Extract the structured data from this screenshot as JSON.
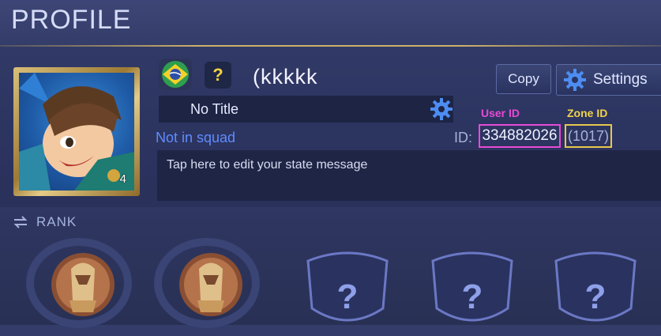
{
  "header": {
    "title": "PROFILE"
  },
  "profile": {
    "avatar_level": "4",
    "country_flag": "brazil-flag-icon",
    "title_badge": "?",
    "player_name": "(kkkkk",
    "title": "No Title",
    "squad_status": "Not in squad",
    "user_id_label": "User ID",
    "zone_id_label": "Zone ID",
    "id_prefix": "ID:",
    "user_id": "334882026",
    "zone_id": "(1017)",
    "state_message": "Tap here to edit your state message"
  },
  "actions": {
    "copy_label": "Copy",
    "settings_label": "Settings"
  },
  "rank": {
    "label": "RANK",
    "slots": [
      {
        "type": "medal",
        "icon": "rank-medal-icon"
      },
      {
        "type": "medal",
        "icon": "rank-medal-icon"
      },
      {
        "type": "unknown",
        "symbol": "?"
      },
      {
        "type": "unknown",
        "symbol": "?"
      },
      {
        "type": "unknown",
        "symbol": "?"
      }
    ]
  },
  "colors": {
    "user_id_highlight": "#e84ad6",
    "zone_id_highlight": "#e7c84a",
    "gold_accent": "#cdb06a",
    "squad_text": "#5f8cff"
  }
}
